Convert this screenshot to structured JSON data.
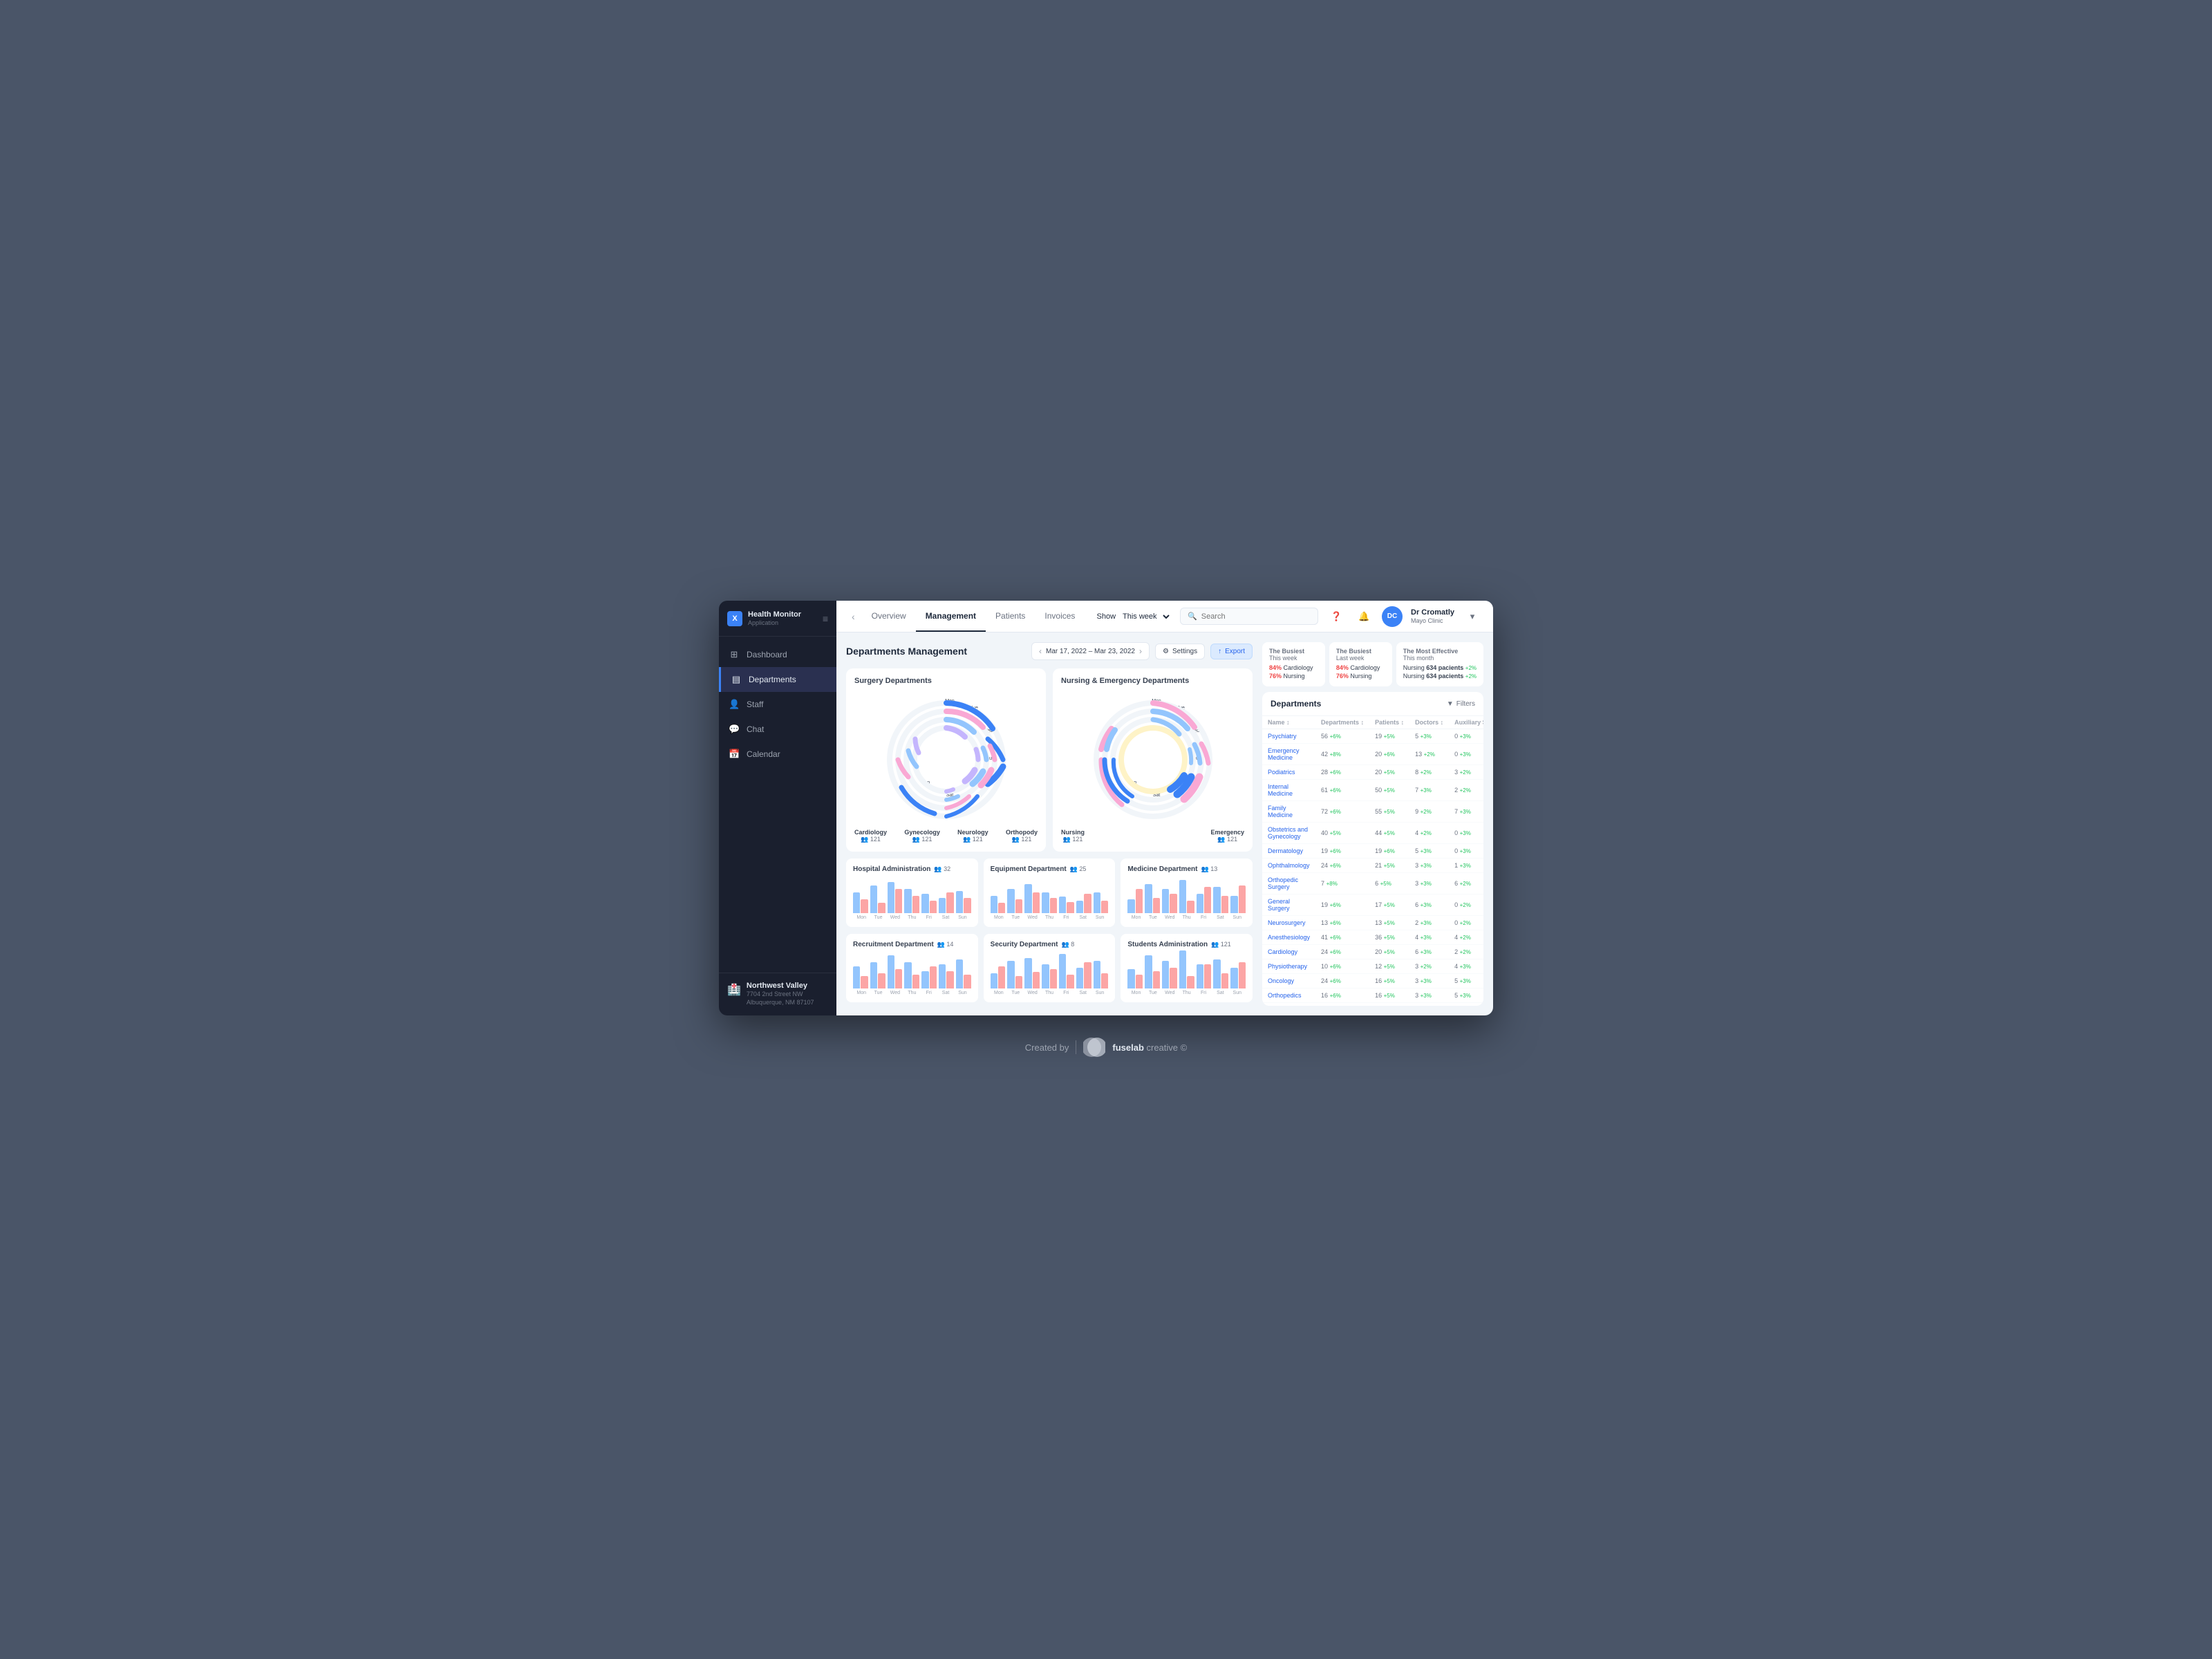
{
  "app": {
    "name": "Health Monitor",
    "sub": "Application",
    "logo_letter": "X"
  },
  "sidebar": {
    "items": [
      {
        "id": "dashboard",
        "label": "Dashboard",
        "icon": "⊞"
      },
      {
        "id": "departments",
        "label": "Departments",
        "icon": "≡",
        "active": true
      },
      {
        "id": "staff",
        "label": "Staff",
        "icon": "👤"
      },
      {
        "id": "chat",
        "label": "Chat",
        "icon": "💬"
      },
      {
        "id": "calendar",
        "label": "Calendar",
        "icon": "📅"
      }
    ],
    "clinic": {
      "name": "Northwest Valley",
      "address": "7704 2nd Street NW\nAlbuquerque, NM 87107"
    }
  },
  "topbar": {
    "tabs": [
      "Overview",
      "Management",
      "Patients",
      "Invoices"
    ],
    "active_tab": "Management",
    "show_label": "Show",
    "show_value": "This week",
    "search_placeholder": "Search"
  },
  "user": {
    "name": "Dr Cromatly",
    "clinic": "Mayo Clinic",
    "initials": "DC"
  },
  "page": {
    "title": "Departments Management",
    "date_range": "Mar 17, 2022 – Mar 23, 2022",
    "settings_label": "Settings",
    "export_label": "Export"
  },
  "surgery_chart": {
    "title": "Surgery Departments",
    "departments": [
      {
        "name": "Cardiology",
        "count": "121"
      },
      {
        "name": "Gynecology",
        "count": "121"
      },
      {
        "name": "Neurology",
        "count": "121"
      },
      {
        "name": "Orthopody",
        "count": "121"
      }
    ],
    "days": [
      "Mon",
      "Tue",
      "Wed",
      "Thu",
      "Fri",
      "Sat",
      "Sun"
    ]
  },
  "nursing_chart": {
    "title": "Nursing & Emergency Departments",
    "departments": [
      {
        "name": "Nursing",
        "count": "121"
      },
      {
        "name": "",
        "count": ""
      },
      {
        "name": "Emergency",
        "count": "121"
      },
      {
        "name": "",
        "count": ""
      }
    ],
    "days": [
      "Mon",
      "Tue",
      "Wed",
      "Thu",
      "Fri",
      "Sat",
      "Sun"
    ]
  },
  "small_charts": [
    {
      "title": "Hospital Administration",
      "count": "32",
      "days": [
        "Mon",
        "Tue",
        "Wed",
        "Thu",
        "Fri",
        "Sat",
        "Sun"
      ],
      "bars": [
        30,
        40,
        70,
        55,
        45,
        35,
        50
      ]
    },
    {
      "title": "Equipment Department",
      "count": "25",
      "days": [
        "Mon",
        "Tue",
        "Wed",
        "Thu",
        "Fri",
        "Sat",
        "Sun"
      ],
      "bars": [
        25,
        35,
        60,
        45,
        40,
        30,
        45
      ]
    },
    {
      "title": "Medicine Department",
      "count": "13",
      "days": [
        "Mon",
        "Tue",
        "Wed",
        "Thu",
        "Fri",
        "Sat",
        "Sun"
      ],
      "bars": [
        20,
        50,
        40,
        65,
        35,
        45,
        30
      ]
    },
    {
      "title": "Recruitment Department",
      "count": "14",
      "days": [
        "Mon",
        "Tue",
        "Wed",
        "Thu",
        "Fri",
        "Sat",
        "Sun"
      ],
      "bars": [
        35,
        40,
        55,
        45,
        30,
        40,
        50
      ]
    },
    {
      "title": "Security Department",
      "count": "8",
      "days": [
        "Mon",
        "Tue",
        "Wed",
        "Thu",
        "Fri",
        "Sat",
        "Sun"
      ],
      "bars": [
        25,
        45,
        50,
        40,
        60,
        35,
        45
      ]
    },
    {
      "title": "Students Administration",
      "count": "121",
      "days": [
        "Mon",
        "Tue",
        "Wed",
        "Thu",
        "Fri",
        "Sat",
        "Sun"
      ],
      "bars": [
        30,
        55,
        45,
        70,
        40,
        50,
        35
      ]
    }
  ],
  "stats": {
    "busiest_week": {
      "label": "The Busiest",
      "sublabel": "This week",
      "items": [
        {
          "percent": "84%",
          "name": "Cardiology"
        },
        {
          "percent": "76%",
          "name": "Nursing"
        }
      ]
    },
    "busiest_last": {
      "label": "The Busiest",
      "sublabel": "Last week",
      "items": [
        {
          "percent": "84%",
          "name": "Cardiology"
        },
        {
          "percent": "76%",
          "name": "Nursing"
        }
      ]
    },
    "most_effective": {
      "label": "The Most Effective",
      "sublabel": "This month",
      "items": [
        {
          "name": "Nursing",
          "patients": "634 pacients",
          "plus": "+2%"
        },
        {
          "name": "Nursing",
          "patients": "634 pacients",
          "plus": "+2%"
        }
      ]
    }
  },
  "departments_table": {
    "title": "Departments",
    "filter_label": "Filters",
    "columns": [
      "Name ↕",
      "Departments ↕",
      "Patients ↕",
      "Doctors ↕",
      "Auxiliary Staff ↕"
    ],
    "rows": [
      {
        "name": "Psychiatry",
        "depts": "56 +6%",
        "patients": "19 +5%",
        "doctors": "5 +3%",
        "aux": "0 +3%"
      },
      {
        "name": "Emergency Medicine",
        "depts": "42 +8%",
        "patients": "20 +6%",
        "doctors": "13 +2%",
        "aux": "0 +3%"
      },
      {
        "name": "Podiatrics",
        "depts": "28 +6%",
        "patients": "20 +5%",
        "doctors": "8 +2%",
        "aux": "3 +2%"
      },
      {
        "name": "Internal Medicine",
        "depts": "61 +6%",
        "patients": "50 +5%",
        "doctors": "7 +3%",
        "aux": "2 +2%"
      },
      {
        "name": "Family Medicine",
        "depts": "72 +6%",
        "patients": "55 +5%",
        "doctors": "9 +2%",
        "aux": "7 +3%"
      },
      {
        "name": "Obstetrics and Gynecology",
        "depts": "40 +5%",
        "patients": "44 +5%",
        "doctors": "4 +2%",
        "aux": "0 +3%"
      },
      {
        "name": "Dermatology",
        "depts": "19 +6%",
        "patients": "19 +6%",
        "doctors": "5 +3%",
        "aux": "0 +3%"
      },
      {
        "name": "Ophthalmology",
        "depts": "24 +6%",
        "patients": "21 +5%",
        "doctors": "3 +3%",
        "aux": "1 +3%"
      },
      {
        "name": "Orthopedic Surgery",
        "depts": "7 +8%",
        "patients": "6 +5%",
        "doctors": "3 +3%",
        "aux": "6 +2%"
      },
      {
        "name": "General Surgery",
        "depts": "19 +6%",
        "patients": "17 +5%",
        "doctors": "6 +3%",
        "aux": "0 +2%"
      },
      {
        "name": "Neurosurgery",
        "depts": "13 +6%",
        "patients": "13 +5%",
        "doctors": "2 +3%",
        "aux": "0 +2%"
      },
      {
        "name": "Anesthesiology",
        "depts": "41 +6%",
        "patients": "36 +5%",
        "doctors": "4 +3%",
        "aux": "4 +2%"
      },
      {
        "name": "Cardiology",
        "depts": "24 +6%",
        "patients": "20 +5%",
        "doctors": "6 +3%",
        "aux": "2 +2%"
      },
      {
        "name": "Physiotherapy",
        "depts": "10 +6%",
        "patients": "12 +5%",
        "doctors": "3 +2%",
        "aux": "4 +3%"
      },
      {
        "name": "Oncology",
        "depts": "24 +6%",
        "patients": "16 +5%",
        "doctors": "3 +3%",
        "aux": "5 +3%"
      },
      {
        "name": "Orthopedics",
        "depts": "16 +6%",
        "patients": "16 +5%",
        "doctors": "3 +3%",
        "aux": "5 +3%"
      }
    ]
  },
  "footer": {
    "text": "Created by",
    "brand": "fuselab",
    "brand2": "creative",
    "copyright": "©"
  }
}
